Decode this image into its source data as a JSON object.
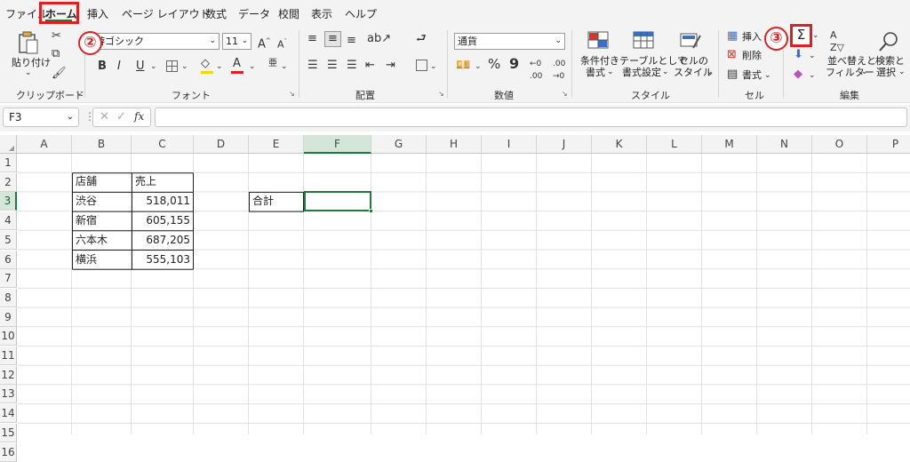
{
  "tabs": [
    "ファイル",
    "ホーム",
    "挿入",
    "ページ レイアウト",
    "数式",
    "データ",
    "校閲",
    "表示",
    "ヘルプ"
  ],
  "clipboard": {
    "paste": "貼り付け",
    "group": "クリップボード"
  },
  "font": {
    "name": "游ゴシック",
    "size": "11",
    "group": "フォント"
  },
  "alignment": {
    "group": "配置"
  },
  "number": {
    "format": "通貨",
    "group": "数値"
  },
  "styles": {
    "cond": "条件付き",
    "cond2": "書式",
    "table": "テーブルとして",
    "table2": "書式設定",
    "cell": "セルの",
    "cell2": "スタイル",
    "group": "スタイル"
  },
  "cells": {
    "insert": "挿入",
    "delete": "削除",
    "format": "書式",
    "group": "セル"
  },
  "editing": {
    "sum": "Σ",
    "sort": "並べ替えと",
    "sort2": "フィルター",
    "find": "検索と",
    "find2": "選択",
    "group": "編集"
  },
  "annotations": {
    "a2": "②",
    "a3": "③"
  },
  "namebox": "F3",
  "fx": "fx",
  "columns": [
    "A",
    "B",
    "C",
    "D",
    "E",
    "F",
    "G",
    "H",
    "I",
    "J",
    "K",
    "L",
    "M",
    "N",
    "O",
    "P"
  ],
  "rows": [
    "1",
    "2",
    "3",
    "4",
    "5",
    "6",
    "7",
    "8",
    "9",
    "10",
    "11",
    "12",
    "13",
    "14",
    "15",
    "16"
  ],
  "table": {
    "header": [
      "店舗",
      "売上"
    ],
    "rows": [
      [
        "渋谷",
        "518,011"
      ],
      [
        "新宿",
        "605,155"
      ],
      [
        "六本木",
        "687,205"
      ],
      [
        "横浜",
        "555,103"
      ]
    ]
  },
  "total_label": "合計",
  "colors": {
    "accent": "#1f7a3e",
    "annotation": "#e02020"
  }
}
